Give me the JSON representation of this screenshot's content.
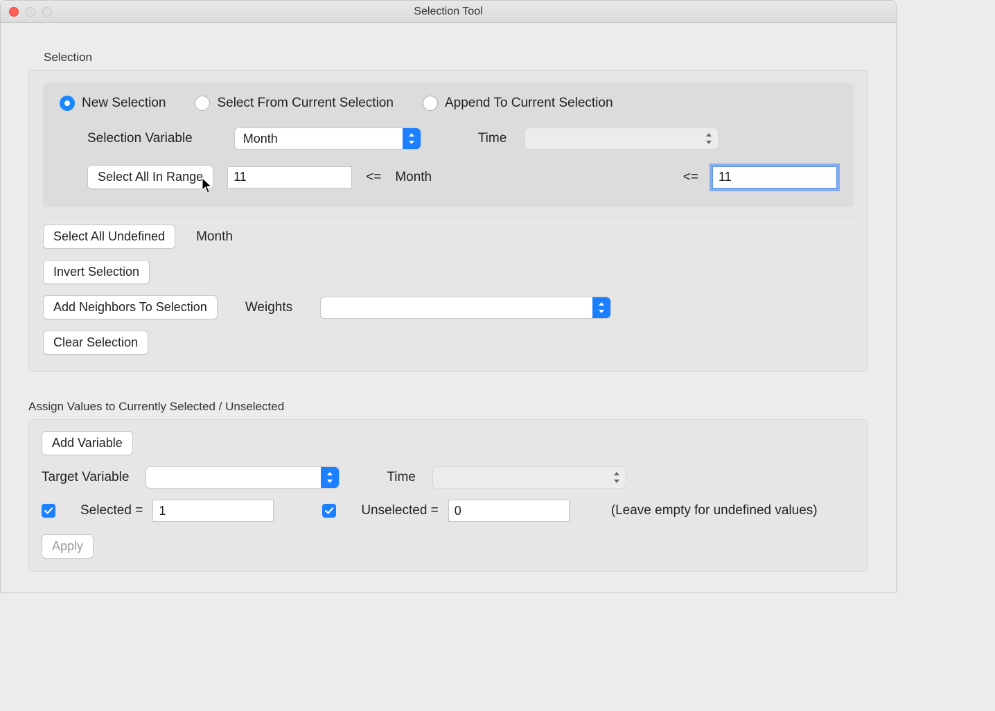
{
  "window": {
    "title": "Selection Tool"
  },
  "section1": {
    "label": "Selection",
    "radios": {
      "new": "New Selection",
      "from_current": "Select From Current Selection",
      "append": "Append To Current Selection"
    },
    "var_label": "Selection Variable",
    "var_combo": "Month",
    "time_label": "Time",
    "time_combo": "",
    "range_btn": "Select All In Range",
    "range_min": "11",
    "range_op1": "<=",
    "range_var": "Month",
    "range_op2": "<=",
    "range_max": "11",
    "undef_btn": "Select All Undefined",
    "undef_var": "Month",
    "invert_btn": "Invert Selection",
    "neighbors_btn": "Add Neighbors To Selection",
    "weights_label": "Weights",
    "weights_combo": "",
    "clear_btn": "Clear Selection"
  },
  "section2": {
    "label": "Assign Values to Currently Selected / Unselected",
    "add_var_btn": "Add Variable",
    "target_label": "Target Variable",
    "target_combo": "",
    "time_label": "Time",
    "time_combo": "",
    "selected_label": "Selected =",
    "selected_value": "1",
    "unselected_label": "Unselected =",
    "unselected_value": "0",
    "hint": "(Leave empty for undefined values)",
    "apply_btn": "Apply"
  }
}
